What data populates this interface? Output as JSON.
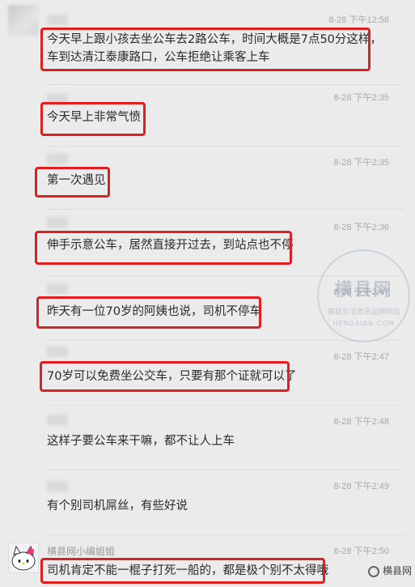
{
  "messages": [
    {
      "time": "8-28 下午12:58",
      "text_lines": [
        "今天早上跟小孩去坐公车去2路公车，时间大概是7点50分这样，",
        "车到达清江泰康路口，公车拒绝让乘客上车"
      ]
    },
    {
      "time": "8-28 下午2:35",
      "text": "今天早上非常气愤"
    },
    {
      "time": "8-28 下午2:35",
      "text": "第一次遇见"
    },
    {
      "time": "8-28 下午2:36",
      "text": "伸手示意公车，居然直接开过去，到站点也不停"
    },
    {
      "time": "8-28 下午2:47",
      "text": "昨天有一位70岁的阿姨也说，司机不停车"
    },
    {
      "time": "8-28 下午2:47",
      "text": "70岁可以免费坐公交车，只要有那个证就可以了"
    },
    {
      "time": "8-28 下午2:48",
      "text": "这样子要公车来干嘛，都不让人上车"
    },
    {
      "time": "8-28 下午2:49",
      "text": "有个别司机屌丝，有些好说"
    },
    {
      "time": "8-28 下午2:50",
      "name": "横县网小编姐姐",
      "text": "司机肯定不能一棍子打死一船的，都是极个别不太得哦"
    }
  ],
  "watermark": {
    "title": "横县网",
    "subtitle": "横县生活资讯品牌网站",
    "en": "HENGXIAN.COM"
  },
  "brand": {
    "label": "横县网"
  }
}
